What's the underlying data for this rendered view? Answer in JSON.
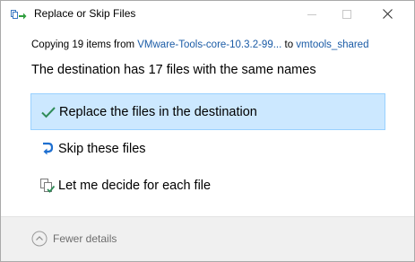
{
  "window": {
    "title": "Replace or Skip Files",
    "minimize_label": "",
    "maximize_label": "",
    "close_label": ""
  },
  "copy": {
    "prefix": "Copying 19 items from ",
    "source": "VMware-Tools-core-10.3.2-99...",
    "middle": " to ",
    "destination": "vmtools_shared"
  },
  "heading": "The destination has 17 files with the same names",
  "options": [
    {
      "label": "Replace the files in the destination",
      "icon": "checkmark-icon",
      "selected": true
    },
    {
      "label": "Skip these files",
      "icon": "skip-arrow-icon",
      "selected": false
    },
    {
      "label": "Let me decide for each file",
      "icon": "compare-files-icon",
      "selected": false
    }
  ],
  "footer": {
    "details_label": "Fewer details",
    "details_icon": "chevron-up-circle-icon"
  },
  "colors": {
    "selection_bg": "#cce8ff",
    "selection_border": "#99d1ff",
    "link": "#1a5ba6",
    "check_green": "#2e8b57",
    "skip_blue": "#1e6fd0",
    "footer_bg": "#f0f0f0"
  }
}
